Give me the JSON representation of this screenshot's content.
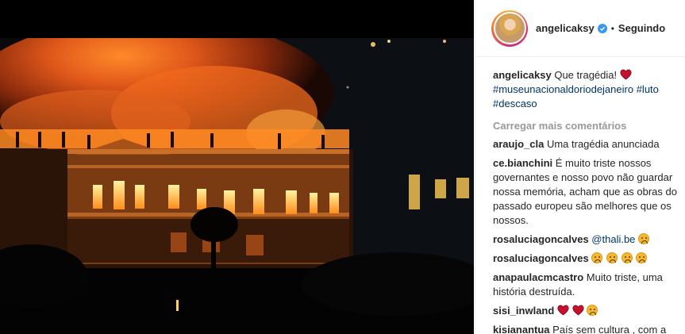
{
  "post": {
    "author": "angelicaksy",
    "follow_status": "Seguindo",
    "separator": "•",
    "caption_text": "Que tragédia!",
    "caption_tags": [
      "#museunacionaldoriodejaneiro",
      "#luto",
      "#descaso"
    ]
  },
  "load_more_label": "Carregar mais comentários",
  "comments": [
    {
      "user": "araujo_cla",
      "text": "Uma tragédia anunciada",
      "emojis": []
    },
    {
      "user": "ce.bianchini",
      "text": "É muito triste nossos governantes e nosso povo não guardar nossa memória, acham que as obras do passado europeu são melhores que os nossos.",
      "emojis": []
    },
    {
      "user": "rosaluciagoncalves",
      "mention": "@thali.be",
      "emojis": [
        "sad"
      ]
    },
    {
      "user": "rosaluciagoncalves",
      "text": "",
      "emojis": [
        "sad",
        "sad",
        "sad",
        "sad"
      ]
    },
    {
      "user": "anapaulacmcastro",
      "text": "Muito triste, uma história destruída.",
      "emojis": []
    },
    {
      "user": "sisi_inwland",
      "text": "",
      "emojis": [
        "heart",
        "heart",
        "sad"
      ]
    },
    {
      "user": "kisianantua",
      "text": "País sem cultura , com a",
      "emojis": []
    }
  ],
  "colors": {
    "verified": "#3897f0",
    "hashtag": "#003569",
    "muted": "#999999",
    "fire": "#ff7a1a"
  },
  "icons": {
    "verified": "verified-badge-icon",
    "heart": "red-heart-icon",
    "sad": "sad-face-icon"
  }
}
